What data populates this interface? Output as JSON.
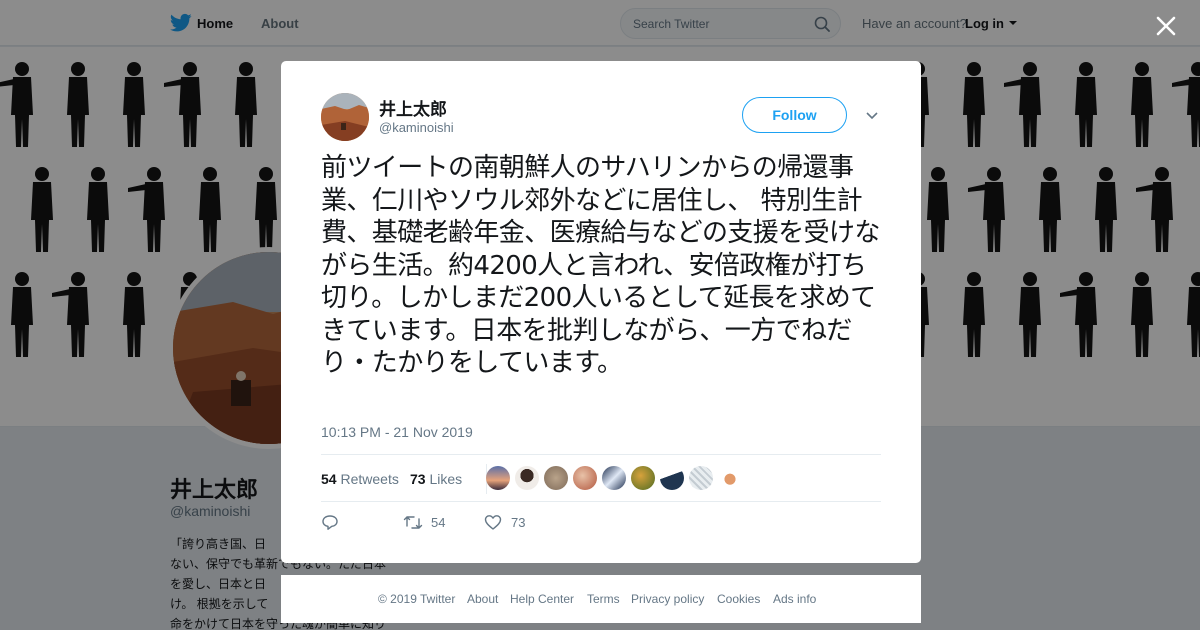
{
  "topbar": {
    "home_label": "Home",
    "about_label": "About",
    "search_placeholder": "Search Twitter",
    "have_account": "Have an account?",
    "login_label": "Log in"
  },
  "profile": {
    "name": "井上太郎",
    "handle": "@kaminoishi",
    "bio_lines": [
      "「誇り高き国、日",
      "ない、保守でも革新でもない。ただ日本",
      "を愛し、日本と日",
      "け。 根拠を示して",
      "命をかけて日本を守った魂が簡単に知り"
    ]
  },
  "tweet": {
    "author_name": "井上太郎",
    "author_handle": "@kaminoishi",
    "follow_label": "Follow",
    "text": "前ツイートの南朝鮮人のサハリンからの帰還事業、仁川やソウル郊外などに居住し、 特別生計費、基礎老齢年金、医療給与などの支援を受けながら生活。約4200人と言われ、安倍政権が打ち切り。しかしまだ200人いるとして延長を求めてきています。日本を批判しながら、一方でねだり・たかりをしています。",
    "timestamp": "10:13 PM - 21 Nov 2019",
    "retweets_count": "54",
    "retweets_label": "Retweets",
    "likes_count": "73",
    "likes_label": "Likes",
    "action_retweets": "54",
    "action_likes": "73"
  },
  "footer": {
    "links": [
      "© 2019 Twitter",
      "About",
      "Help Center",
      "Terms",
      "Privacy policy",
      "Cookies",
      "Ads info"
    ]
  },
  "icons": {
    "brand": "twitter-bird-icon",
    "close": "close-icon",
    "search": "search-icon",
    "reply": "reply-icon",
    "retweet": "retweet-icon",
    "like": "heart-icon"
  },
  "colors": {
    "brand": "#1da1f2",
    "text": "#14171a",
    "muted": "#657786"
  }
}
